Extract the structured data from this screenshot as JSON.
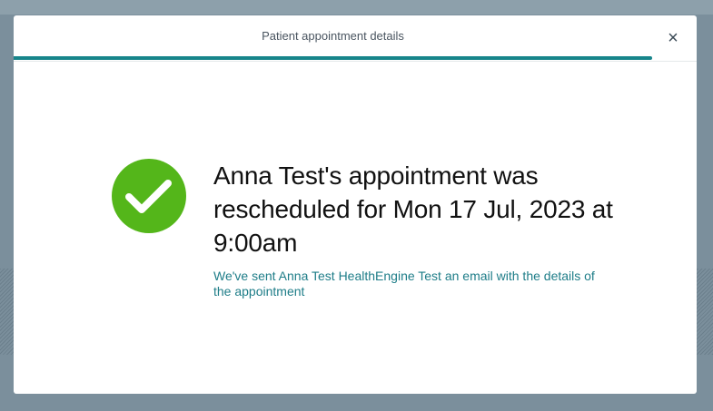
{
  "modal": {
    "title": "Patient appointment details",
    "close_label": "×",
    "progress_fraction": 1.0
  },
  "confirmation": {
    "icon": "check-circle-icon",
    "heading": "Anna Test's appointment was rescheduled for Mon 17 Jul, 2023 at 9:00am",
    "subtext": "We've sent Anna Test HealthEngine Test an email with the details of the appointment"
  },
  "colors": {
    "accent": "#17858b",
    "success": "#54b61a",
    "link_text": "#1e7d88"
  }
}
